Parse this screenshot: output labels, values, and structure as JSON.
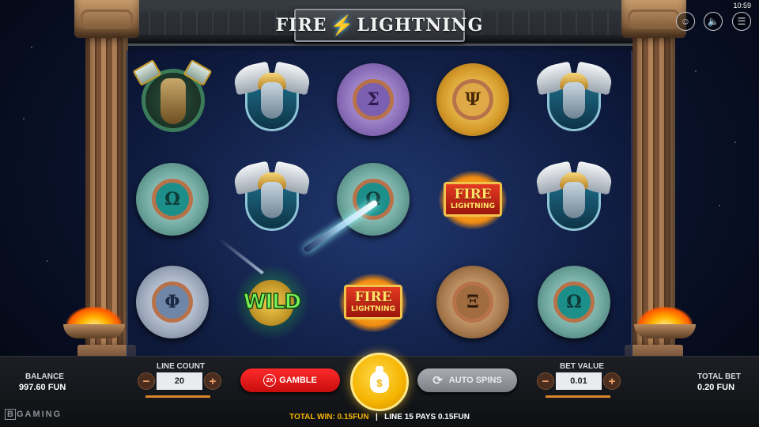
{
  "header": {
    "logo_left": "FIRE",
    "logo_right": "LIGHTNING",
    "time": "10:59"
  },
  "top_buttons": [
    {
      "name": "character-icon",
      "glyph": "☺"
    },
    {
      "name": "sound-icon",
      "glyph": "🔈"
    },
    {
      "name": "menu-icon",
      "glyph": "☰"
    }
  ],
  "reels": {
    "grid": [
      [
        "zeus",
        "helmet",
        "sigma",
        "psi",
        "helmet"
      ],
      [
        "omega-teal",
        "helmet",
        "omega-teal",
        "fire-lightning",
        "helmet"
      ],
      [
        "phi",
        "wild",
        "fire-lightning",
        "xi",
        "omega-silver"
      ]
    ],
    "symbols": {
      "sigma": {
        "letter": "Σ",
        "style": "m-purple"
      },
      "psi": {
        "letter": "Ψ",
        "style": "m-gold"
      },
      "omega-teal": {
        "letter": "Ω",
        "style": "m-teal"
      },
      "phi": {
        "letter": "Φ",
        "style": "m-silver"
      },
      "xi": {
        "letter": "Ξ",
        "style": "m-bronze"
      },
      "omega-silver": {
        "letter": "Ω",
        "style": "m-teal"
      }
    },
    "fire_logo_top": "FIRE",
    "fire_logo_bottom": "LIGHTNING",
    "wild_text": "WILD"
  },
  "bottom": {
    "balance_label": "BALANCE",
    "balance_value": "997.60 FUN",
    "line_count_label": "LINE COUNT",
    "line_count_value": "20",
    "gamble_badge": "2X",
    "gamble_label": "GAMBLE",
    "spin_glyph": "$",
    "auto_spins_label": "AUTO SPINS",
    "bet_value_label": "BET VALUE",
    "bet_value": "0.01",
    "total_bet_label": "TOTAL BET",
    "total_bet_value": "0.20 FUN",
    "total_win_label": "TOTAL WIN:",
    "total_win_value": "0.15FUN",
    "separator": "|",
    "line_pays": "LINE 15 PAYS",
    "line_pays_value": "0.15FUN",
    "minus": "−",
    "plus": "+",
    "brand_b": "B",
    "brand_rest": "GAMING"
  }
}
